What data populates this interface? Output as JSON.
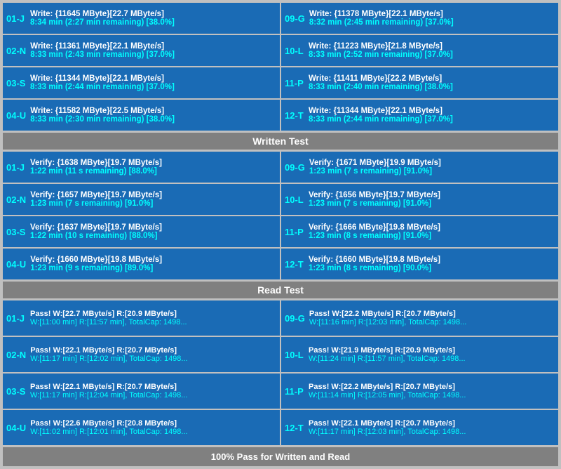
{
  "sections": {
    "write": {
      "header": "Written Test",
      "cells": [
        {
          "label": "01-J",
          "line1": "Write: {11645 MByte}[22.7 MByte/s]",
          "line2": "8:34 min (2:27 min remaining)  [38.0%]"
        },
        {
          "label": "09-G",
          "line1": "Write: {11378 MByte}[22.1 MByte/s]",
          "line2": "8:32 min (2:45 min remaining)  [37.0%]"
        },
        {
          "label": "02-N",
          "line1": "Write: {11361 MByte}[22.1 MByte/s]",
          "line2": "8:33 min (2:43 min remaining)  [37.0%]"
        },
        {
          "label": "10-L",
          "line1": "Write: {11223 MByte}[21.8 MByte/s]",
          "line2": "8:33 min (2:52 min remaining)  [37.0%]"
        },
        {
          "label": "03-S",
          "line1": "Write: {11344 MByte}[22.1 MByte/s]",
          "line2": "8:33 min (2:44 min remaining)  [37.0%]"
        },
        {
          "label": "11-P",
          "line1": "Write: {11411 MByte}[22.2 MByte/s]",
          "line2": "8:33 min (2:40 min remaining)  [38.0%]"
        },
        {
          "label": "04-U",
          "line1": "Write: {11582 MByte}[22.5 MByte/s]",
          "line2": "8:33 min (2:30 min remaining)  [38.0%]"
        },
        {
          "label": "12-T",
          "line1": "Write: {11344 MByte}[22.1 MByte/s]",
          "line2": "8:33 min (2:44 min remaining)  [37.0%]"
        }
      ]
    },
    "verify": {
      "header": "Written Test",
      "cells": [
        {
          "label": "01-J",
          "line1": "Verify: {1638 MByte}[19.7 MByte/s]",
          "line2": "1:22 min (11 s remaining)   [88.0%]"
        },
        {
          "label": "09-G",
          "line1": "Verify: {1671 MByte}[19.9 MByte/s]",
          "line2": "1:23 min (7 s remaining)   [91.0%]"
        },
        {
          "label": "02-N",
          "line1": "Verify: {1657 MByte}[19.7 MByte/s]",
          "line2": "1:23 min (7 s remaining)   [91.0%]"
        },
        {
          "label": "10-L",
          "line1": "Verify: {1656 MByte}[19.7 MByte/s]",
          "line2": "1:23 min (7 s remaining)   [91.0%]"
        },
        {
          "label": "03-S",
          "line1": "Verify: {1637 MByte}[19.7 MByte/s]",
          "line2": "1:22 min (10 s remaining)   [88.0%]"
        },
        {
          "label": "11-P",
          "line1": "Verify: {1666 MByte}[19.8 MByte/s]",
          "line2": "1:23 min (8 s remaining)   [91.0%]"
        },
        {
          "label": "04-U",
          "line1": "Verify: {1660 MByte}[19.8 MByte/s]",
          "line2": "1:23 min (9 s remaining)   [89.0%]"
        },
        {
          "label": "12-T",
          "line1": "Verify: {1660 MByte}[19.8 MByte/s]",
          "line2": "1:23 min (8 s remaining)   [90.0%]"
        }
      ]
    },
    "read": {
      "header": "Read Test",
      "cells": [
        {
          "label": "01-J",
          "line1": "Pass! W:[22.7 MByte/s] R:[20.9 MByte/s]",
          "line2": "W:[11:00 min] R:[11:57 min], TotalCap: 1498..."
        },
        {
          "label": "09-G",
          "line1": "Pass! W:[22.2 MByte/s] R:[20.7 MByte/s]",
          "line2": "W:[11:16 min] R:[12:03 min], TotalCap: 1498..."
        },
        {
          "label": "02-N",
          "line1": "Pass! W:[22.1 MByte/s] R:[20.7 MByte/s]",
          "line2": "W:[11:17 min] R:[12:02 min], TotalCap: 1498..."
        },
        {
          "label": "10-L",
          "line1": "Pass! W:[21.9 MByte/s] R:[20.9 MByte/s]",
          "line2": "W:[11:24 min] R:[11:57 min], TotalCap: 1498..."
        },
        {
          "label": "03-S",
          "line1": "Pass! W:[22.1 MByte/s] R:[20.7 MByte/s]",
          "line2": "W:[11:17 min] R:[12:04 min], TotalCap: 1498..."
        },
        {
          "label": "11-P",
          "line1": "Pass! W:[22.2 MByte/s] R:[20.7 MByte/s]",
          "line2": "W:[11:14 min] R:[12:05 min], TotalCap: 1498..."
        },
        {
          "label": "04-U",
          "line1": "Pass! W:[22.6 MByte/s] R:[20.8 MByte/s]",
          "line2": "W:[11:02 min] R:[12:01 min], TotalCap: 1498..."
        },
        {
          "label": "12-T",
          "line1": "Pass! W:[22.1 MByte/s] R:[20.7 MByte/s]",
          "line2": "W:[11:17 min] R:[12:03 min], TotalCap: 1498..."
        }
      ]
    }
  },
  "footer": "100% Pass for Written and Read"
}
